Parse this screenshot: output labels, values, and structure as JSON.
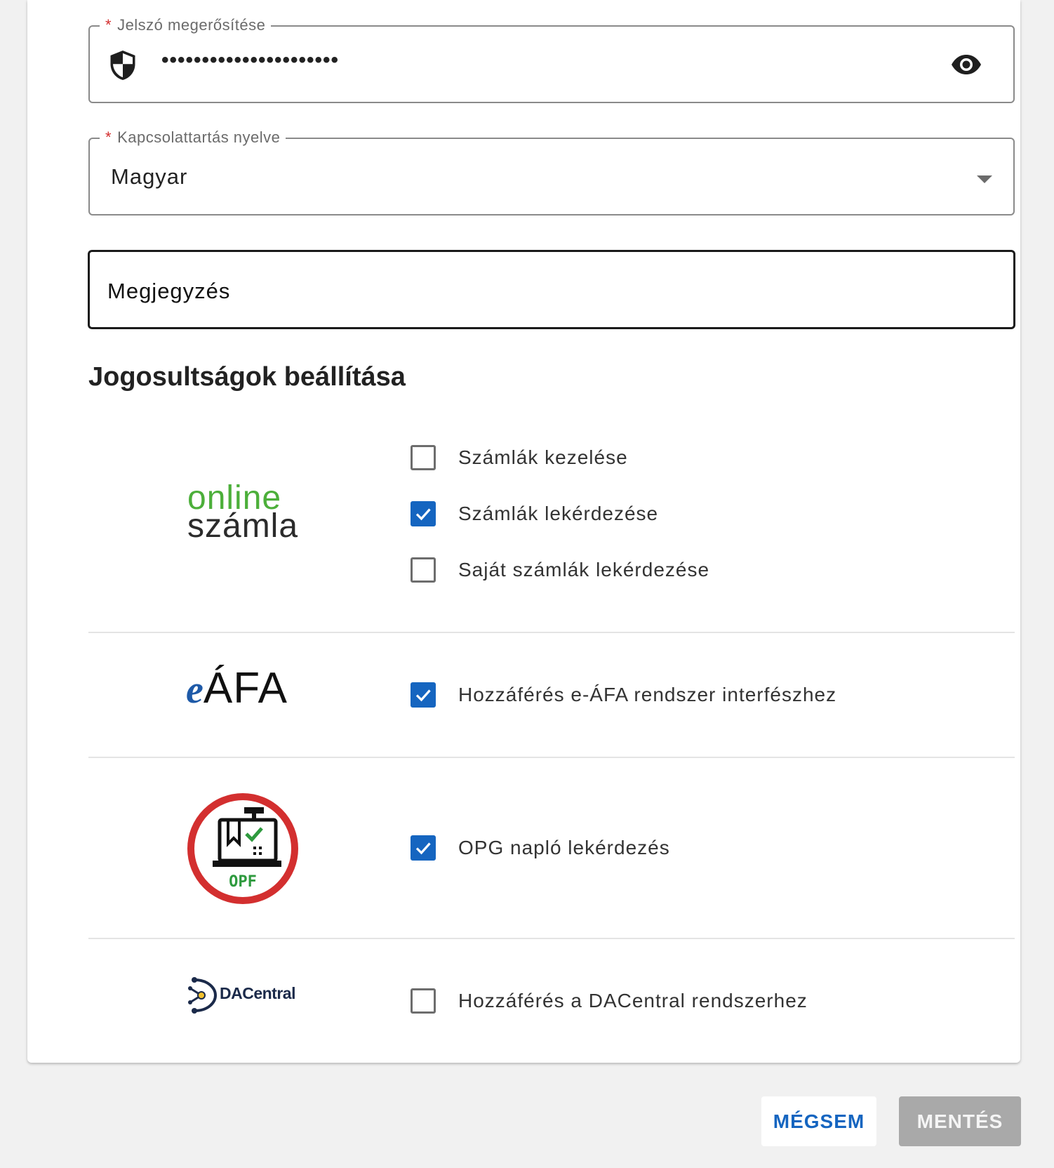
{
  "form": {
    "password_confirm": {
      "required_mark": "*",
      "label": "Jelszó megerősítése",
      "value": "••••••••••••••••••••••"
    },
    "language": {
      "required_mark": "*",
      "label": "Kapcsolattartás nyelve",
      "value": "Magyar"
    },
    "note": {
      "label": "Megjegyzés"
    }
  },
  "permissions": {
    "title": "Jogosultságok beállítása",
    "online_szamla": {
      "logo_line1": "online",
      "logo_line2": "számla",
      "items": [
        {
          "label": "Számlák kezelése",
          "checked": false
        },
        {
          "label": "Számlák lekérdezése",
          "checked": true
        },
        {
          "label": "Saját számlák lekérdezése",
          "checked": false
        }
      ]
    },
    "eafa": {
      "logo_e": "e",
      "logo_afa": "ÁFA",
      "items": [
        {
          "label": "Hozzáférés e-ÁFA rendszer interfészhez",
          "checked": true
        }
      ]
    },
    "opf": {
      "logo_text": "OPF",
      "items": [
        {
          "label": "OPG napló lekérdezés",
          "checked": true
        }
      ]
    },
    "dacentral": {
      "logo_text": "DACentral",
      "items": [
        {
          "label": "Hozzáférés a DACentral rendszerhez",
          "checked": false
        }
      ]
    }
  },
  "actions": {
    "cancel_label": "MÉGSEM",
    "save_label": "MENTÉS"
  },
  "colors": {
    "accent": "#1565c0",
    "required": "#d32f2f",
    "online_green": "#4caf3a",
    "opf_red": "#d32f2f",
    "opf_green": "#2e9a3e",
    "save_disabled": "#a9a9a9"
  },
  "icons": {
    "password_field": "shield-icon",
    "visibility": "eye-icon",
    "dropdown": "caret-down-icon"
  }
}
